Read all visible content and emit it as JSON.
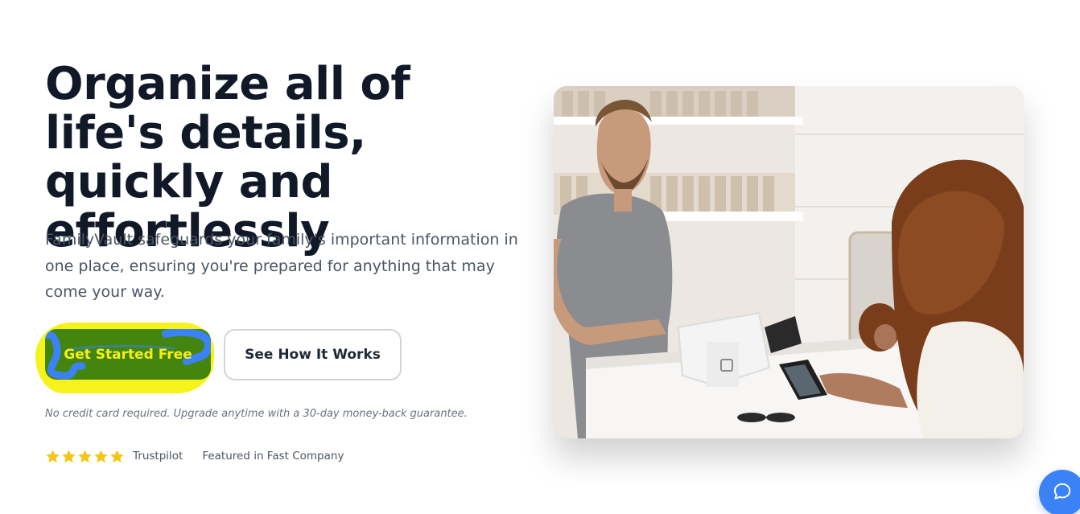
{
  "hero": {
    "title": "Organize all of life's details, quickly and effortlessly",
    "subtitle": "FamilyVault safeguards your family's important information in one place, ensuring you're prepared for anything that may come your way."
  },
  "cta": {
    "primary_label": "Get Started Free",
    "secondary_label": "See How It Works"
  },
  "disclaimer": "No credit card required. Upgrade anytime with a 30-day money-back guarantee.",
  "trust": {
    "rating_stars": 5,
    "rating_source": "Trustpilot",
    "featured": "Featured in Fast Company"
  },
  "image": {
    "alt": "Man at a shop counter smiling while a customer with curly hair pays with her phone"
  },
  "chat": {
    "icon": "chat-bubble-icon"
  },
  "colors": {
    "title": "#111827",
    "body": "#4b5563",
    "primary_button": "#43850f",
    "primary_button_text": "#f4ef1a",
    "highlight": "#f6f21c",
    "scribble": "#3b82f6",
    "star": "#f5c518",
    "chat": "#3b82f6"
  }
}
